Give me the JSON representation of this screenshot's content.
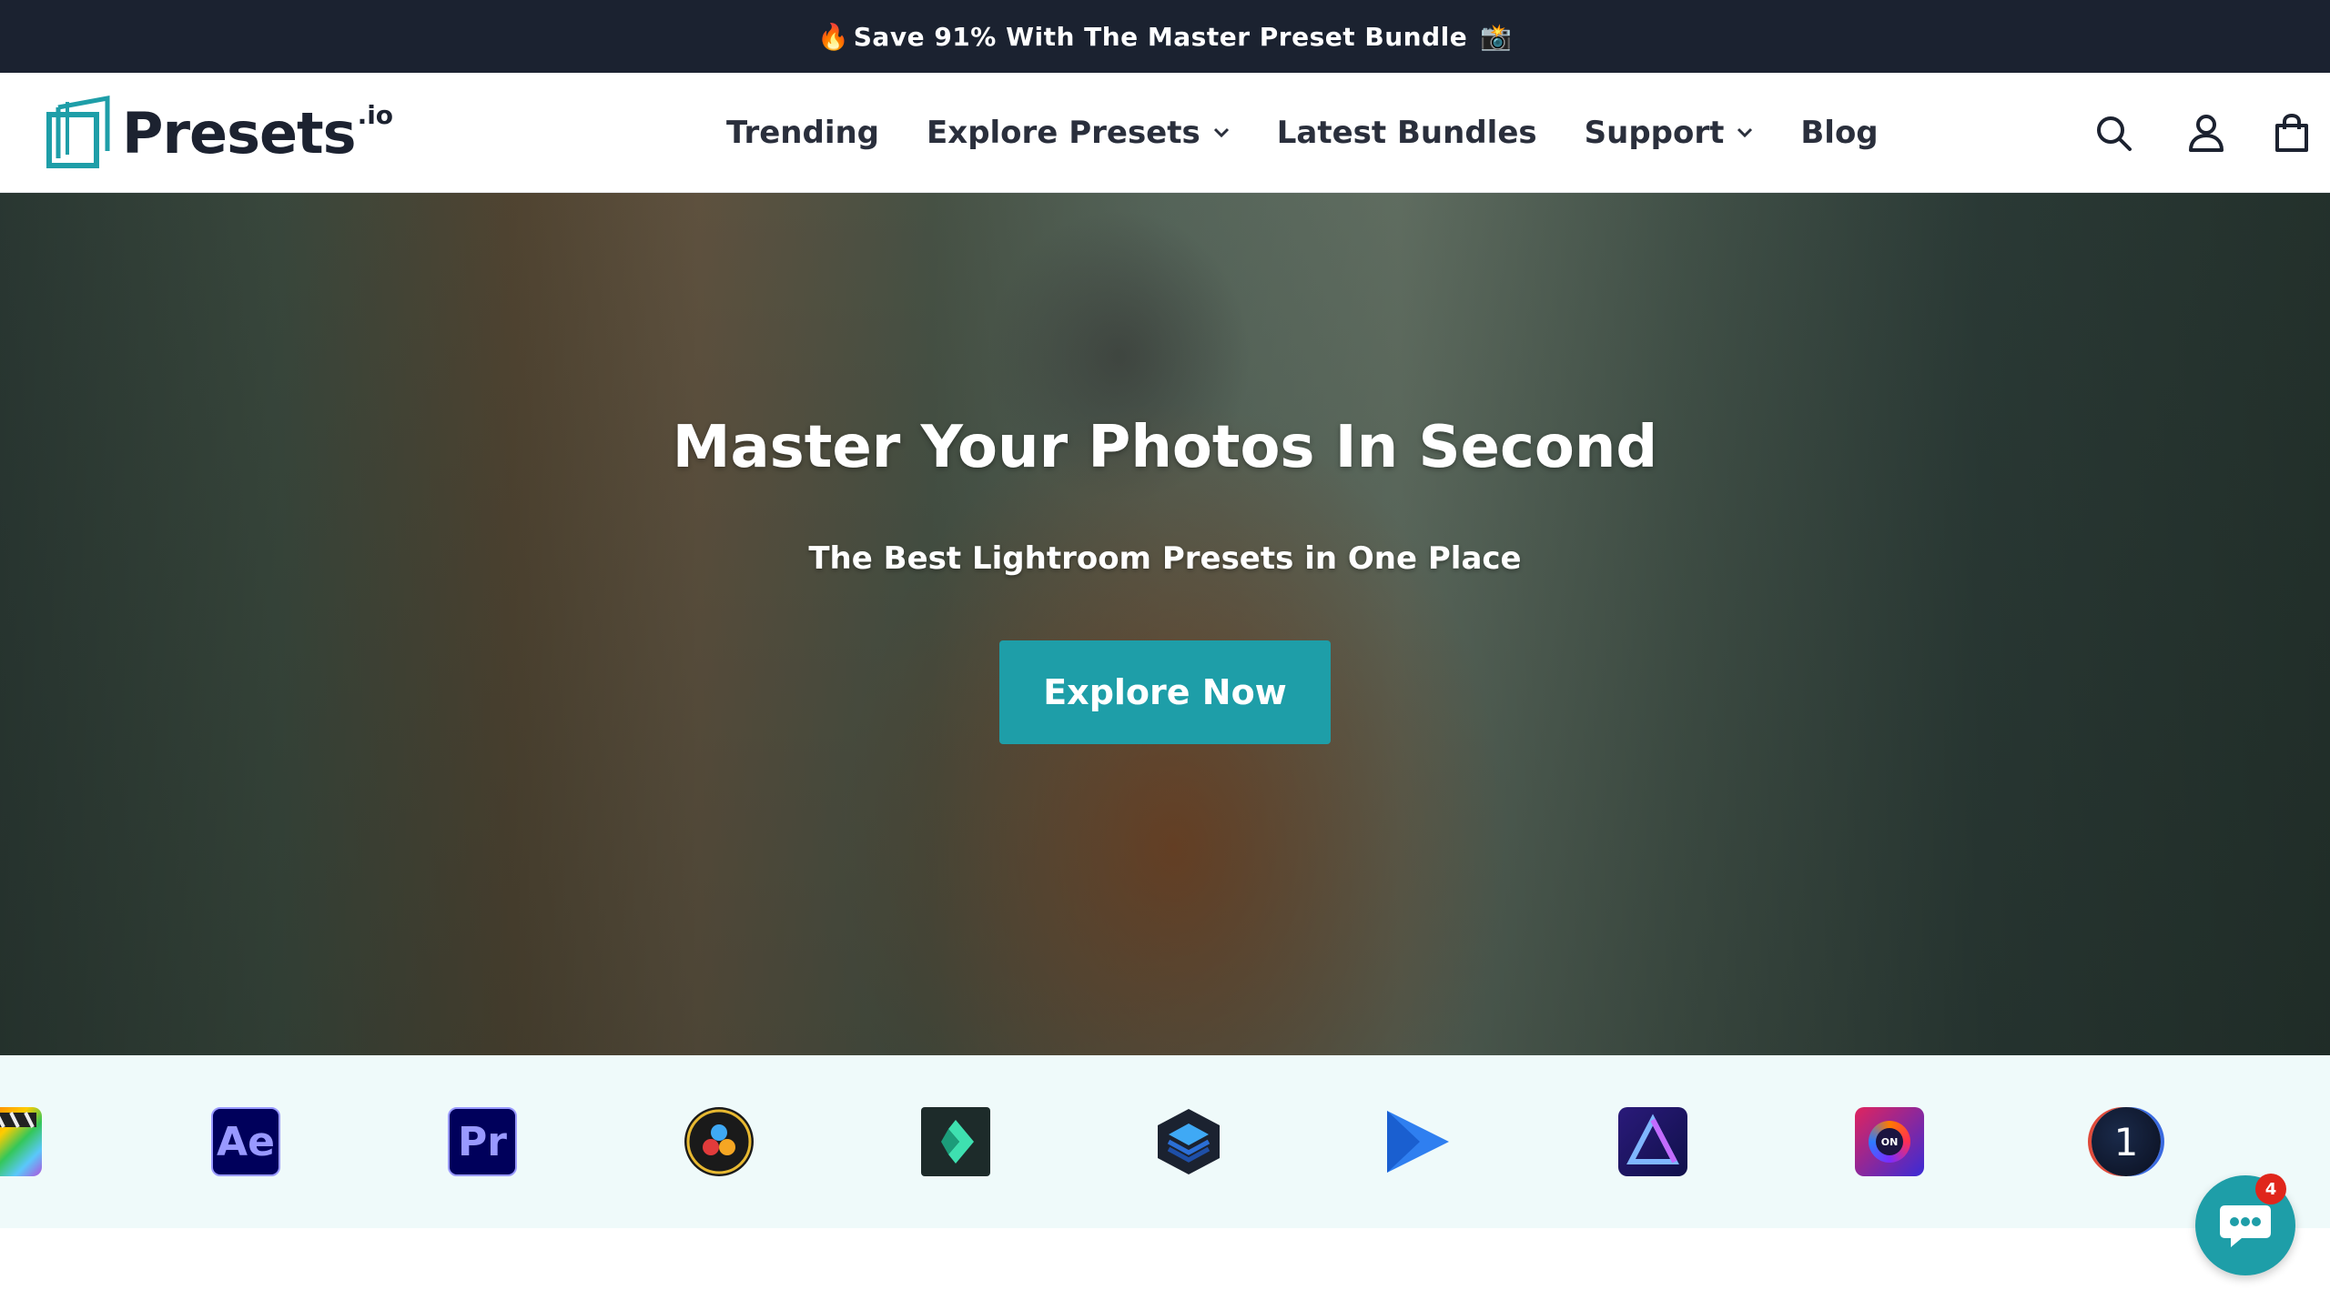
{
  "announcement": {
    "emoji_left": "🔥",
    "text": "Save 91% With The Master Preset Bundle",
    "emoji_right": "📸"
  },
  "brand": {
    "name": "Presets",
    "suffix": ".io"
  },
  "nav": {
    "items": [
      {
        "label": "Trending",
        "has_dropdown": false
      },
      {
        "label": "Explore Presets",
        "has_dropdown": true
      },
      {
        "label": "Latest Bundles",
        "has_dropdown": false
      },
      {
        "label": "Support",
        "has_dropdown": true
      },
      {
        "label": "Blog",
        "has_dropdown": false
      }
    ]
  },
  "header_icons": [
    "search-icon",
    "account-icon",
    "cart-icon"
  ],
  "hero": {
    "title": "Master Your Photos In Second",
    "subtitle": "The Best Lightroom Presets in One Place",
    "cta_label": "Explore Now"
  },
  "apps": {
    "items": [
      {
        "icon": "final-cut-pro-icon",
        "text": ""
      },
      {
        "icon": "after-effects-icon",
        "text": "Ae"
      },
      {
        "icon": "premiere-pro-icon",
        "text": "Pr"
      },
      {
        "icon": "davinci-resolve-icon",
        "text": ""
      },
      {
        "icon": "filmora-icon",
        "text": ""
      },
      {
        "icon": "layers-app-icon",
        "text": ""
      },
      {
        "icon": "play-video-app-icon",
        "text": ""
      },
      {
        "icon": "luminar-icon",
        "text": ""
      },
      {
        "icon": "on1-photo-icon",
        "text": "ON"
      },
      {
        "icon": "capture-one-icon",
        "text": "1"
      }
    ]
  },
  "chat": {
    "badge_count": "4"
  },
  "colors": {
    "announcement_bg": "#1b2230",
    "accent": "#1e9ea8",
    "app_strip_bg": "#effafa",
    "badge": "#e0261b"
  }
}
